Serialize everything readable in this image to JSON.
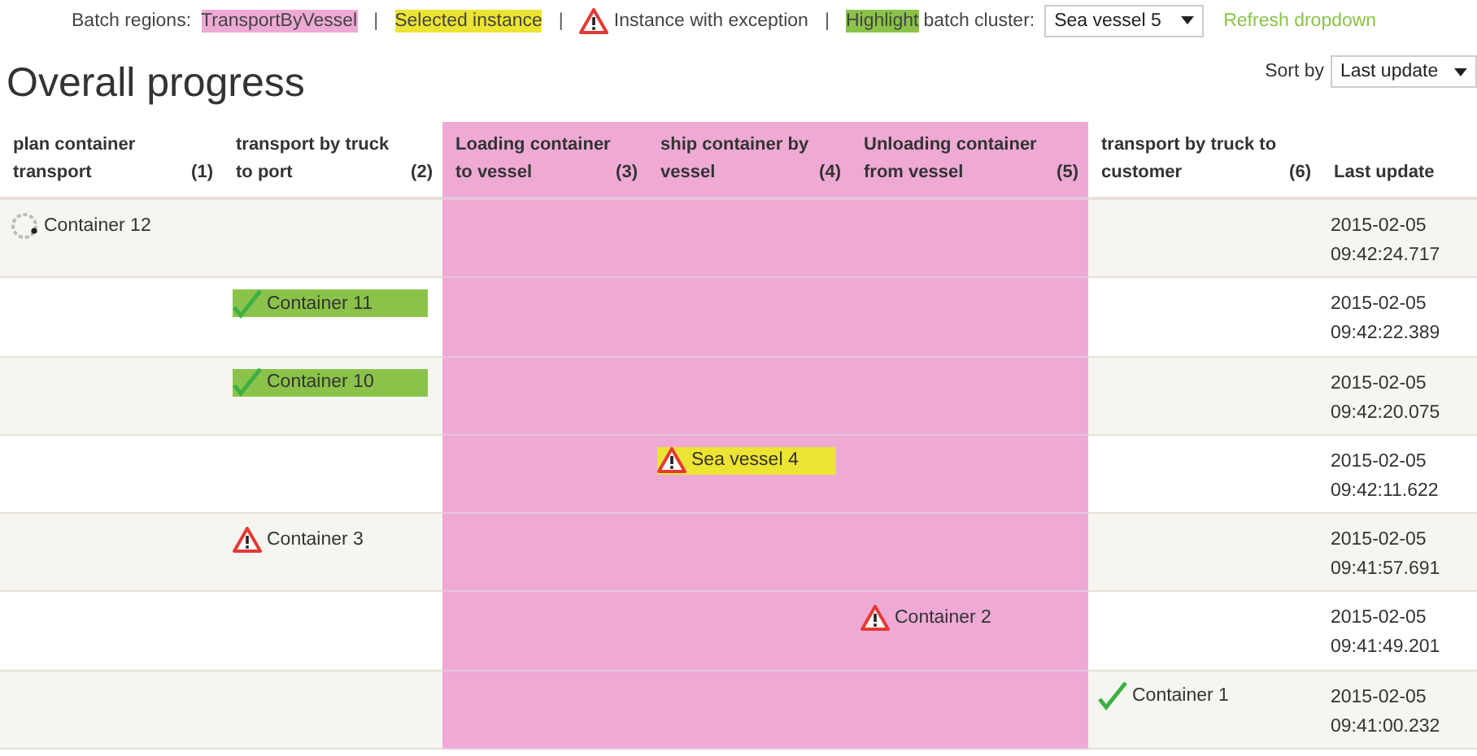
{
  "legend": {
    "regions_label": "Batch regions:",
    "region_name": "TransportByVessel",
    "separator": "|",
    "selected_label": "Selected instance",
    "exception_label": "Instance with exception",
    "highlight_label": "Highlight",
    "cluster_label": "batch cluster:",
    "cluster_value": "Sea vessel 5",
    "refresh_link": "Refresh dropdown"
  },
  "title": "Overall progress",
  "sort": {
    "label": "Sort by",
    "value": "Last update"
  },
  "columns": [
    {
      "title": "plan container transport",
      "number": "(1)",
      "in_region": false
    },
    {
      "title": "transport by truck to port",
      "number": "(2)",
      "in_region": false
    },
    {
      "title": "Loading container to vessel",
      "number": "(3)",
      "in_region": true
    },
    {
      "title": "ship container by vessel",
      "number": "(4)",
      "in_region": true
    },
    {
      "title": "Unloading container from vessel",
      "number": "(5)",
      "in_region": true
    },
    {
      "title": "transport by truck to customer",
      "number": "(6)",
      "in_region": false
    }
  ],
  "last_update_heading": "Last update",
  "rows": [
    {
      "cells": [
        {
          "kind": "running",
          "label": "Container 12",
          "highlighted": false,
          "selected": false
        },
        {
          "kind": "empty"
        },
        {
          "kind": "empty"
        },
        {
          "kind": "empty"
        },
        {
          "kind": "empty"
        },
        {
          "kind": "empty"
        }
      ],
      "date": "2015-02-05",
      "time": "09:42:24.717"
    },
    {
      "cells": [
        {
          "kind": "empty"
        },
        {
          "kind": "done",
          "label": "Container 11",
          "highlighted": true,
          "selected": false
        },
        {
          "kind": "empty"
        },
        {
          "kind": "empty"
        },
        {
          "kind": "empty"
        },
        {
          "kind": "empty"
        }
      ],
      "date": "2015-02-05",
      "time": "09:42:22.389"
    },
    {
      "cells": [
        {
          "kind": "empty"
        },
        {
          "kind": "done",
          "label": "Container 10",
          "highlighted": true,
          "selected": false
        },
        {
          "kind": "empty"
        },
        {
          "kind": "empty"
        },
        {
          "kind": "empty"
        },
        {
          "kind": "empty"
        }
      ],
      "date": "2015-02-05",
      "time": "09:42:20.075"
    },
    {
      "cells": [
        {
          "kind": "empty"
        },
        {
          "kind": "empty"
        },
        {
          "kind": "empty"
        },
        {
          "kind": "exception",
          "label": "Sea vessel 4",
          "highlighted": false,
          "selected": true
        },
        {
          "kind": "empty"
        },
        {
          "kind": "empty"
        }
      ],
      "date": "2015-02-05",
      "time": "09:42:11.622"
    },
    {
      "cells": [
        {
          "kind": "empty"
        },
        {
          "kind": "exception",
          "label": "Container 3",
          "highlighted": false,
          "selected": false
        },
        {
          "kind": "empty"
        },
        {
          "kind": "empty"
        },
        {
          "kind": "empty"
        },
        {
          "kind": "empty"
        }
      ],
      "date": "2015-02-05",
      "time": "09:41:57.691"
    },
    {
      "cells": [
        {
          "kind": "empty"
        },
        {
          "kind": "empty"
        },
        {
          "kind": "empty"
        },
        {
          "kind": "empty"
        },
        {
          "kind": "exception",
          "label": "Container 2",
          "highlighted": false,
          "selected": false
        },
        {
          "kind": "empty"
        }
      ],
      "date": "2015-02-05",
      "time": "09:41:49.201"
    },
    {
      "cells": [
        {
          "kind": "empty"
        },
        {
          "kind": "empty"
        },
        {
          "kind": "empty"
        },
        {
          "kind": "empty"
        },
        {
          "kind": "empty"
        },
        {
          "kind": "done",
          "label": "Container 1",
          "highlighted": false,
          "selected": false
        }
      ],
      "date": "2015-02-05",
      "time": "09:41:00.232"
    }
  ]
}
